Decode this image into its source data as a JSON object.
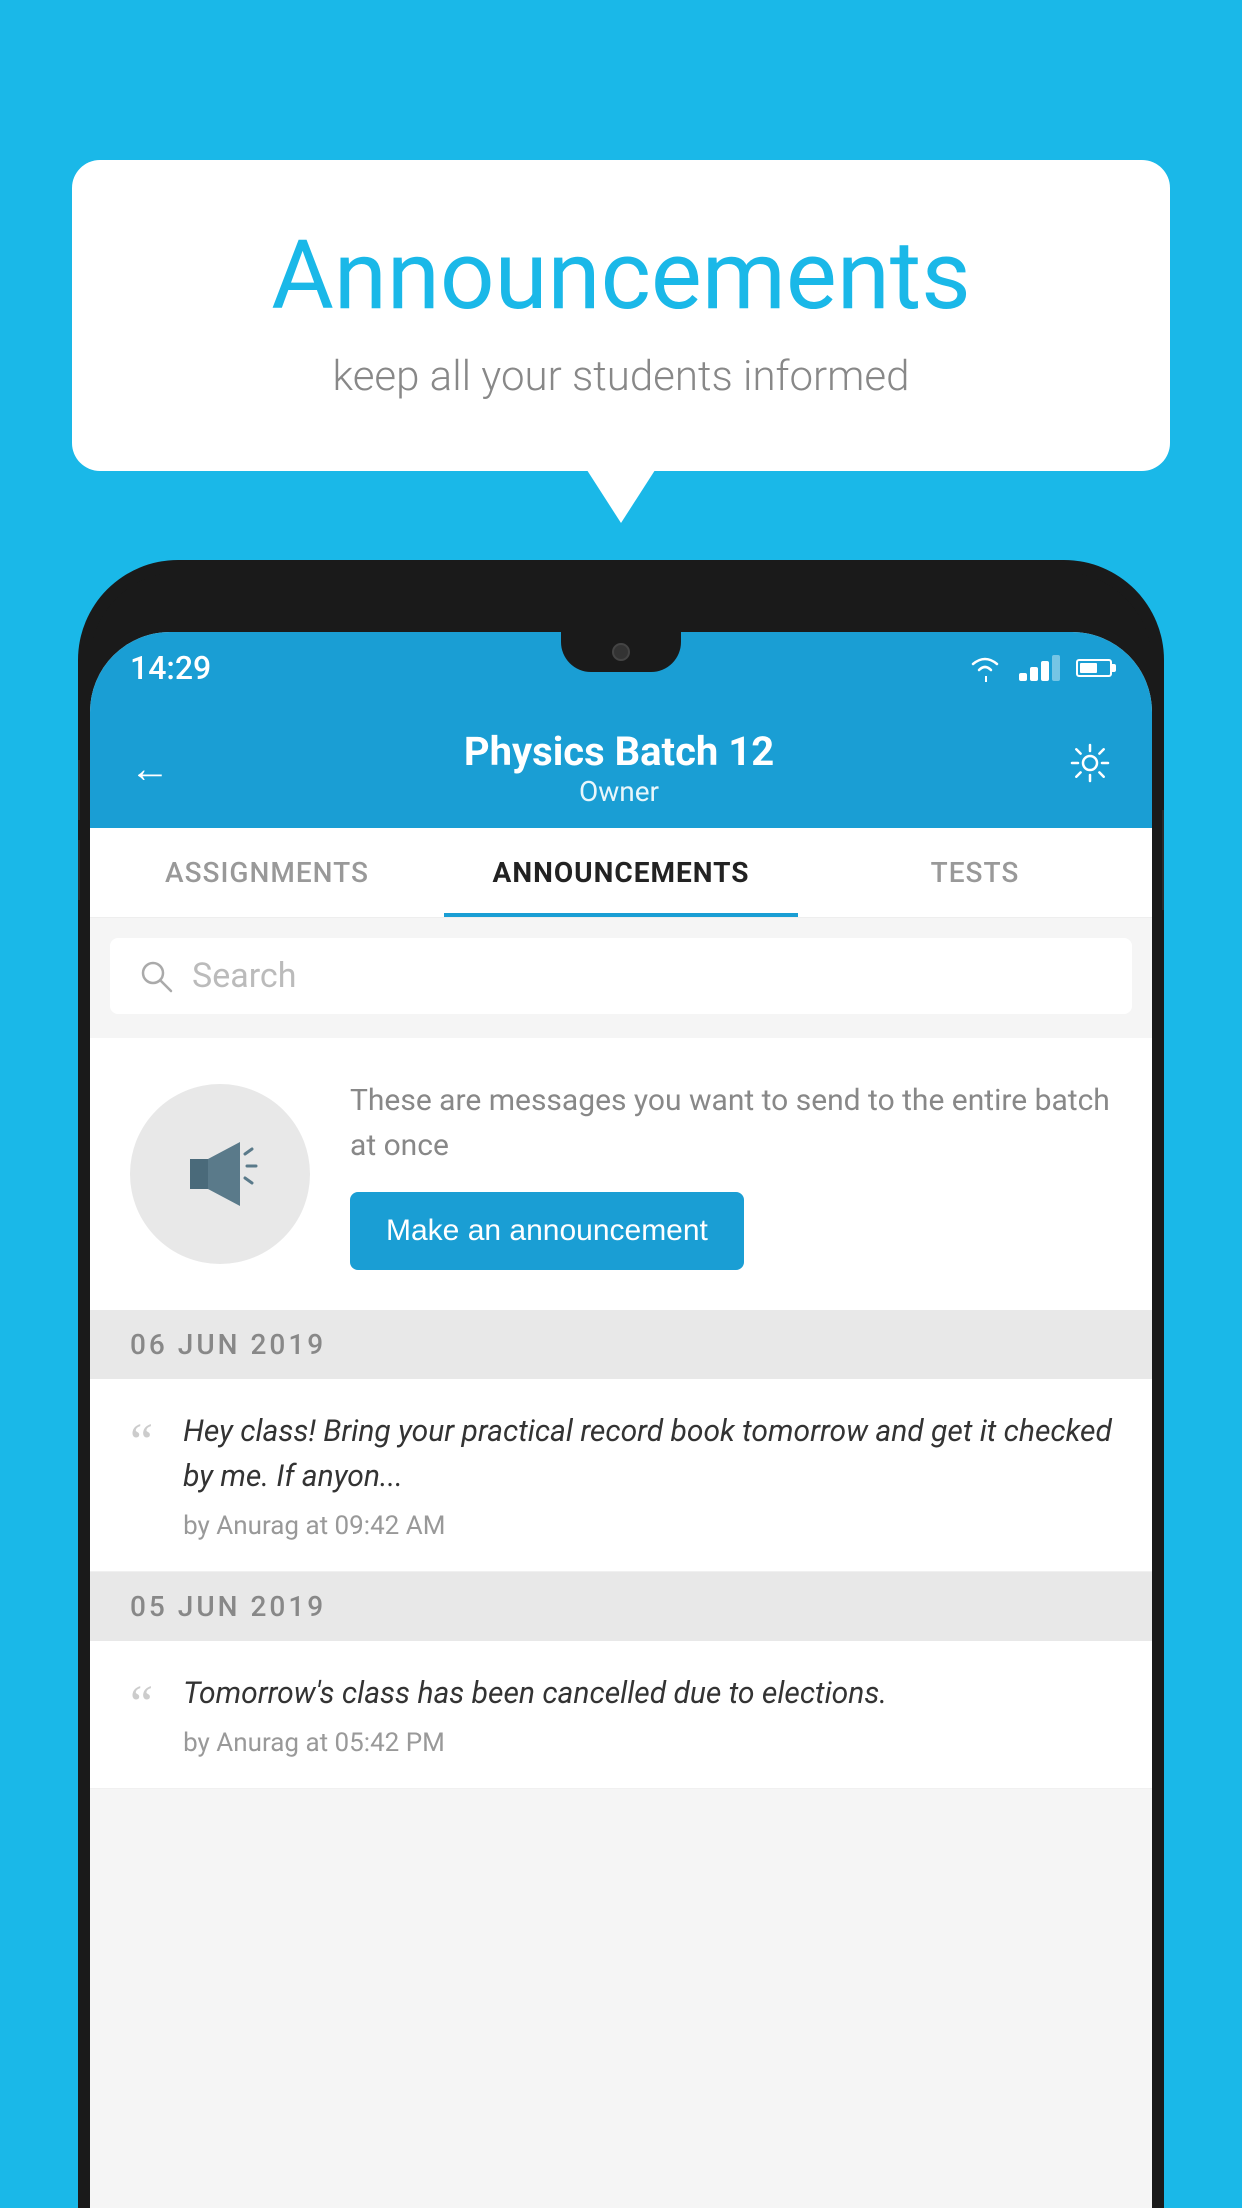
{
  "header": {
    "title": "Announcements",
    "subtitle": "keep all your students informed"
  },
  "phone": {
    "statusBar": {
      "time": "14:29"
    },
    "appHeader": {
      "title": "Physics Batch 12",
      "subtitle": "Owner",
      "backIcon": "←",
      "settingsIcon": "⚙"
    },
    "tabs": [
      {
        "label": "ASSIGNMENTS",
        "active": false
      },
      {
        "label": "ANNOUNCEMENTS",
        "active": true
      },
      {
        "label": "TESTS",
        "active": false
      }
    ],
    "search": {
      "placeholder": "Search"
    },
    "promo": {
      "description": "These are messages you want to send to the entire batch at once",
      "buttonLabel": "Make an announcement"
    },
    "announcements": [
      {
        "date": "06  JUN  2019",
        "items": [
          {
            "text": "Hey class! Bring your practical record book tomorrow and get it checked by me. If anyon...",
            "meta": "by Anurag at 09:42 AM"
          }
        ]
      },
      {
        "date": "05  JUN  2019",
        "items": [
          {
            "text": "Tomorrow's class has been cancelled due to elections.",
            "meta": "by Anurag at 05:42 PM"
          }
        ]
      }
    ]
  }
}
